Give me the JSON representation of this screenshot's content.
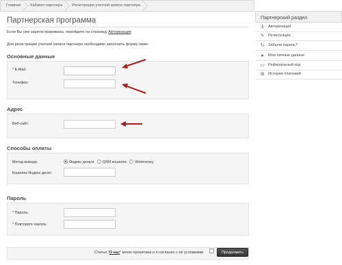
{
  "breadcrumb": [
    "Главная",
    "Кабинет партнера",
    "Регистрация учетной записи партнера"
  ],
  "page_title": "Партнерская программа",
  "intro": {
    "text": "Если Вы уже зарегистрированы, перейдите на страницу",
    "link": "Авторизация"
  },
  "intro2": "Для регистрации учетной записи партнера необходимо заполнить форму ниже:",
  "sections": {
    "basic": {
      "title": "Основные данные",
      "email_label": "E-Mail:",
      "phone_label": "Телефон:"
    },
    "address": {
      "title": "Адрес",
      "site_label": "Веб-сайт:"
    },
    "payment": {
      "title": "Способы оплаты",
      "method_label": "Метод вывода:",
      "options": [
        "Яндекс деньги",
        "QIWI кошелек",
        "Webmoney"
      ],
      "wallet_label": "Кошелек Яндекс денег:"
    },
    "password": {
      "title": "Пароль",
      "password_label": "Пароль:",
      "repeat_label": "Повторите пароль:"
    }
  },
  "required_mark": "*",
  "agreement": {
    "before": "Статья \"",
    "link": "О нас",
    "after": "\" мною прочитана и я согласен с её условиями"
  },
  "continue_button": "Продолжить",
  "sidebar": {
    "title": "Партнерский раздел",
    "items": [
      {
        "label": "Авторизация",
        "icon": "key-icon"
      },
      {
        "label": "Регистрация",
        "icon": "pencil-icon"
      },
      {
        "label": "Забыли пароль?",
        "icon": "refresh-icon"
      },
      {
        "label": "Мои личные данные",
        "icon": "user-icon"
      },
      {
        "label": "Реферальный код",
        "icon": "card-icon"
      },
      {
        "label": "История платежей",
        "icon": "grid-icon"
      }
    ]
  },
  "colors": {
    "arrow": "#a61b1b",
    "required": "#cc0000"
  }
}
